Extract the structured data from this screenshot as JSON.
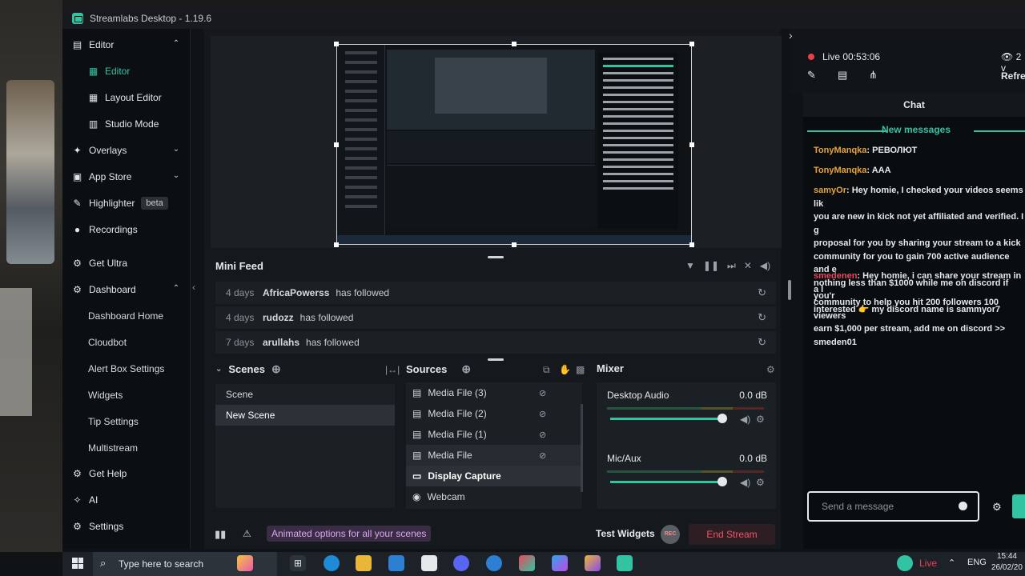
{
  "window": {
    "title": "Streamlabs Desktop - 1.19.6"
  },
  "sidebar": {
    "items": [
      {
        "label": "Editor",
        "icon": "editor-icon"
      },
      {
        "label": "Editor",
        "icon": "editor-sub-icon",
        "active": true
      },
      {
        "label": "Layout Editor",
        "icon": "layout-icon"
      },
      {
        "label": "Studio Mode",
        "icon": "studio-icon"
      },
      {
        "label": "Overlays",
        "icon": "overlays-icon"
      },
      {
        "label": "App Store",
        "icon": "store-icon"
      },
      {
        "label": "Highlighter",
        "icon": "highlighter-icon",
        "badge": "beta"
      },
      {
        "label": "Recordings",
        "icon": "recordings-icon"
      },
      {
        "label": "Get Ultra",
        "icon": "ultra-icon"
      },
      {
        "label": "Dashboard",
        "icon": "dashboard-icon"
      },
      {
        "label": "Dashboard Home"
      },
      {
        "label": "Cloudbot"
      },
      {
        "label": "Alert Box Settings"
      },
      {
        "label": "Widgets"
      },
      {
        "label": "Tip Settings"
      },
      {
        "label": "Multistream"
      },
      {
        "label": "Get Help",
        "icon": "help-icon"
      },
      {
        "label": "AI",
        "icon": "ai-icon"
      },
      {
        "label": "Settings",
        "icon": "settings-icon"
      }
    ]
  },
  "minifeed": {
    "title": "Mini Feed",
    "rows": [
      {
        "days": "4 days",
        "user": "AfricaPowerss",
        "action": "has followed"
      },
      {
        "days": "4 days",
        "user": "rudozz",
        "action": "has followed"
      },
      {
        "days": "7 days",
        "user": "arullahs",
        "action": "has followed"
      }
    ]
  },
  "scenes": {
    "title": "Scenes",
    "items": [
      {
        "label": "Scene"
      },
      {
        "label": "New Scene",
        "selected": true
      }
    ]
  },
  "sources": {
    "title": "Sources",
    "items": [
      {
        "label": "Media File (3)",
        "icon": "file-icon"
      },
      {
        "label": "Media File (2)",
        "icon": "file-icon"
      },
      {
        "label": "Media File (1)",
        "icon": "file-icon"
      },
      {
        "label": "Media File",
        "icon": "file-icon"
      },
      {
        "label": "Display Capture",
        "icon": "monitor-icon"
      },
      {
        "label": "Webcam",
        "icon": "webcam-icon"
      }
    ]
  },
  "mixer": {
    "title": "Mixer",
    "channels": [
      {
        "name": "Desktop Audio",
        "db": "0.0 dB",
        "level": 0.73
      },
      {
        "name": "Mic/Aux",
        "db": "0.0 dB",
        "level": 0.73
      }
    ]
  },
  "footer": {
    "promo": "Animated options for all your scenes",
    "test_widgets": "Test Widgets",
    "rec": "REC",
    "end_stream": "End Stream"
  },
  "live": {
    "status": "Live 00:53:06",
    "viewers": "2 v",
    "refresh": "Refres"
  },
  "chat": {
    "title": "Chat",
    "new_messages": "New messages",
    "messages": [
      {
        "user": "TonyManqka",
        "text": ": РЕВОЛЮТ"
      },
      {
        "user": "TonyManqka",
        "text": ": AAA"
      },
      {
        "user": "samyOr",
        "text": ": Hey homie, I checked your videos seems lik\nyou are new in kick not yet affiliated and verified. I g\nproposal for you by sharing your stream to a kick\ncommunity for you to gain 700 active audience and e\nnothing less than $1000 while me on discord if you'r\ninterested 👉 my discord name is sammyor7"
      },
      {
        "user": "smedenen",
        "text": ": Hey homie, i can share your stream in a l\ncommunity to help you hit 200 followers 100 viewers\nearn $1,000 per stream, add me on discord >>\nsmeden01"
      }
    ],
    "input_placeholder": "Send a message"
  },
  "taskbar": {
    "search_placeholder": "Type here to search",
    "live": "Live",
    "lang": "ENG",
    "time": "15:44",
    "date": "26/02/20"
  },
  "colors": {
    "accent": "#31c3a2",
    "danger": "#f0556a",
    "background": "#0f1316"
  }
}
